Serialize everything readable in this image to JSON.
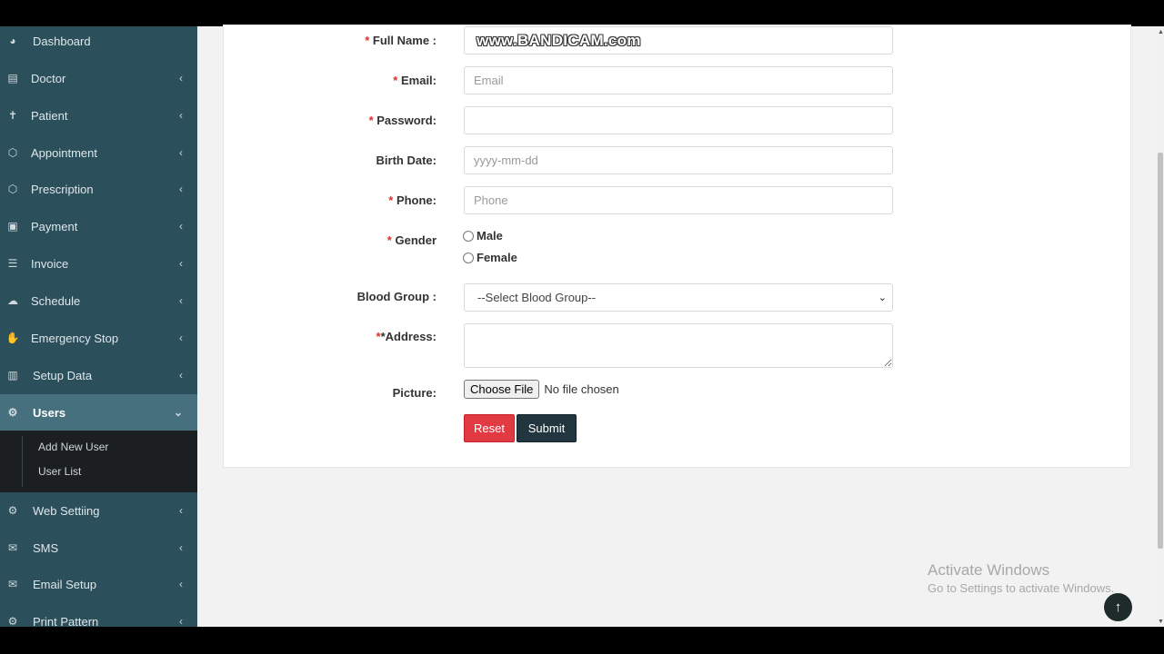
{
  "sidebar": {
    "items": [
      {
        "label": "Dashboard",
        "icon": "dashboard-icon",
        "glyph": "◕"
      },
      {
        "label": "Doctor",
        "icon": "doctor-icon",
        "glyph": "▤"
      },
      {
        "label": "Patient",
        "icon": "patient-icon",
        "glyph": "✝"
      },
      {
        "label": "Appointment",
        "icon": "appointment-icon",
        "glyph": "⬡"
      },
      {
        "label": "Prescription",
        "icon": "prescription-icon",
        "glyph": "⬡"
      },
      {
        "label": "Payment",
        "icon": "payment-icon",
        "glyph": "▣"
      },
      {
        "label": "Invoice",
        "icon": "invoice-icon",
        "glyph": "☰"
      },
      {
        "label": "Schedule",
        "icon": "schedule-icon",
        "glyph": "☁"
      },
      {
        "label": "Emergency Stop",
        "icon": "hand-icon",
        "glyph": "✋"
      },
      {
        "label": "Setup Data",
        "icon": "bar-chart-icon",
        "glyph": "▥"
      },
      {
        "label": "Users",
        "icon": "cogs-icon",
        "glyph": "⚙"
      },
      {
        "label": "Web Settiing",
        "icon": "cogs-icon",
        "glyph": "⚙"
      },
      {
        "label": "SMS",
        "icon": "envelope-icon",
        "glyph": "✉"
      },
      {
        "label": "Email Setup",
        "icon": "envelope-icon",
        "glyph": "✉"
      },
      {
        "label": "Print Pattern",
        "icon": "cogs-icon",
        "glyph": "⚙"
      }
    ],
    "users_submenu": [
      "Add New User",
      "User List"
    ],
    "chevron_left": "‹",
    "chevron_down": "⌄"
  },
  "form": {
    "full_name_label": "Full Name :",
    "email_label": "Email:",
    "email_placeholder": "Email",
    "password_label": "Password:",
    "birth_date_label": "Birth Date:",
    "birth_date_placeholder": "yyyy-mm-dd",
    "phone_label": "Phone:",
    "phone_placeholder": "Phone",
    "gender_label": "Gender",
    "gender_male": "Male",
    "gender_female": "Female",
    "blood_group_label": "Blood Group :",
    "blood_group_selected": "--Select Blood Group--",
    "address_label": "*Address:",
    "picture_label": "Picture:",
    "choose_file": "Choose File",
    "no_file": "No file chosen",
    "reset": "Reset",
    "submit": "Submit",
    "required_mark": "*"
  },
  "overlay": {
    "watermark": "www.BANDICAM.com",
    "activate_title": "Activate Windows",
    "activate_sub": "Go to Settings to activate Windows.",
    "back_to_top": "↑"
  },
  "colors": {
    "sidebar_bg": "#2c4f5c",
    "sidebar_active": "#46707d",
    "reset_btn": "#e13a43",
    "submit_btn": "#22363f",
    "required": "#d9312b"
  }
}
